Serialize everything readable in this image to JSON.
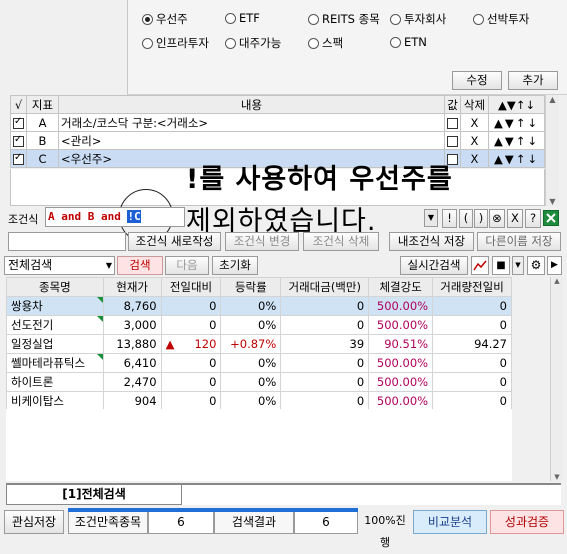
{
  "radios": [
    {
      "label": "우선주",
      "selected": true
    },
    {
      "label": "ETF",
      "selected": false
    },
    {
      "label": "REITS 종목",
      "selected": false
    },
    {
      "label": "투자회사",
      "selected": false
    },
    {
      "label": "선박투자",
      "selected": false
    },
    {
      "label": "인프라투자",
      "selected": false
    },
    {
      "label": "대주가능",
      "selected": false
    },
    {
      "label": "스팩",
      "selected": false
    },
    {
      "label": "ETN",
      "selected": false
    }
  ],
  "buttons": {
    "edit": "수정",
    "add": "추가"
  },
  "cond_table": {
    "headers": [
      "√",
      "지표",
      "내용",
      "값",
      "삭제",
      "▲▼↑↓"
    ],
    "rows": [
      {
        "checked": true,
        "index": "A",
        "content": "거래소/코스닥 구분:<거래소>",
        "delete": "X",
        "arrows": "▲▼↑↓"
      },
      {
        "checked": true,
        "index": "B",
        "content": "<관리>",
        "delete": "X",
        "arrows": "▲▼↑↓"
      },
      {
        "checked": true,
        "index": "C",
        "content": "<우선주>",
        "delete": "X",
        "arrows": "▲▼↑↓"
      }
    ]
  },
  "overlay": {
    "line1": "!를 사용하여 우선주를",
    "line2": "제외하였습니다."
  },
  "formula": {
    "label": "조건식",
    "a_and_b": "A and B and",
    "not_c": "!C",
    "buttons": [
      "!",
      "(",
      ")",
      "⊗",
      "X",
      "?"
    ]
  },
  "cond_buttons": {
    "new": "조건식 새로작성",
    "modify": "조건식 변경",
    "delete": "조건식 삭제",
    "my_save": "내조건식 저장",
    "save_as": "다른이름 저장"
  },
  "toolbar": {
    "scope": "전체검색",
    "search": "검색",
    "next": "다음",
    "reset": "초기화",
    "realtime": "실시간검색"
  },
  "grid": {
    "headers": [
      "종목명",
      "현재가",
      "전일대비",
      "등락률",
      "거래대금(백만)",
      "체결강도",
      "거래량전일비"
    ],
    "rows": [
      {
        "name": "쌍용차",
        "price": "8,760",
        "change": "0",
        "rate": "0%",
        "amount": "0",
        "strength": "500.00%",
        "vol": "0",
        "up": false,
        "sel": true,
        "flag": true
      },
      {
        "name": "선도전기",
        "price": "3,000",
        "change": "0",
        "rate": "0%",
        "amount": "0",
        "strength": "500.00%",
        "vol": "0",
        "up": false,
        "sel": false,
        "flag": true
      },
      {
        "name": "일정실업",
        "price": "13,880",
        "change": "120",
        "rate": "+0.87%",
        "amount": "39",
        "strength": "90.51%",
        "vol": "94.27",
        "up": true,
        "sel": false,
        "flag": false
      },
      {
        "name": "쎌마테라퓨틱스",
        "price": "6,410",
        "change": "0",
        "rate": "0%",
        "amount": "0",
        "strength": "500.00%",
        "vol": "0",
        "up": false,
        "sel": false,
        "flag": true
      },
      {
        "name": "하이트론",
        "price": "2,470",
        "change": "0",
        "rate": "0%",
        "amount": "0",
        "strength": "500.00%",
        "vol": "0",
        "up": false,
        "sel": false,
        "flag": false
      },
      {
        "name": "비케이탑스",
        "price": "904",
        "change": "0",
        "rate": "0%",
        "amount": "0",
        "strength": "500.00%",
        "vol": "0",
        "up": false,
        "sel": false,
        "flag": false
      }
    ]
  },
  "tab": {
    "label": "[1]전체검색"
  },
  "bottom": {
    "save_interest": "관심저장",
    "match_label": "조건만족종목",
    "match_count": "6",
    "result_label": "검색결과",
    "result_count": "6",
    "progress_text": "100%진행",
    "progress": 1.0,
    "compare": "비교분석",
    "verify": "성과검증"
  }
}
